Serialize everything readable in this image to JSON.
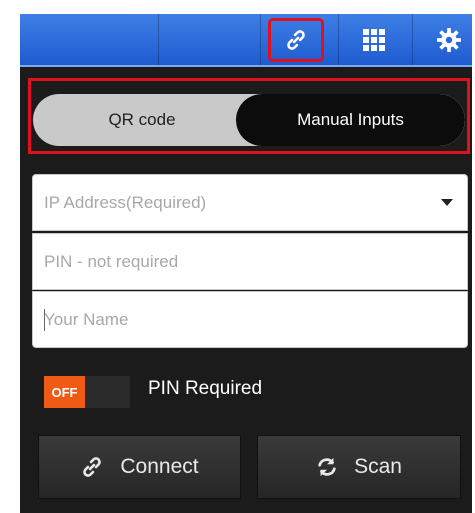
{
  "toolbar": {
    "icons": [
      "link-icon",
      "grid-icon",
      "gear-icon"
    ]
  },
  "mode_toggle": {
    "qr_label": "QR code",
    "manual_label": "Manual Inputs",
    "selected": "Manual Inputs"
  },
  "form": {
    "ip_placeholder": "IP Address(Required)",
    "pin_placeholder": "PIN - not required",
    "name_placeholder": "Your Name"
  },
  "pin_switch": {
    "state_label": "OFF",
    "label": "PIN Required"
  },
  "actions": {
    "connect_label": "Connect",
    "scan_label": "Scan"
  },
  "colors": {
    "toolbar_blue": "#2a67dc",
    "highlight_red": "#e0101c",
    "switch_orange": "#f05a14",
    "background_dark": "#1b1b1b"
  }
}
